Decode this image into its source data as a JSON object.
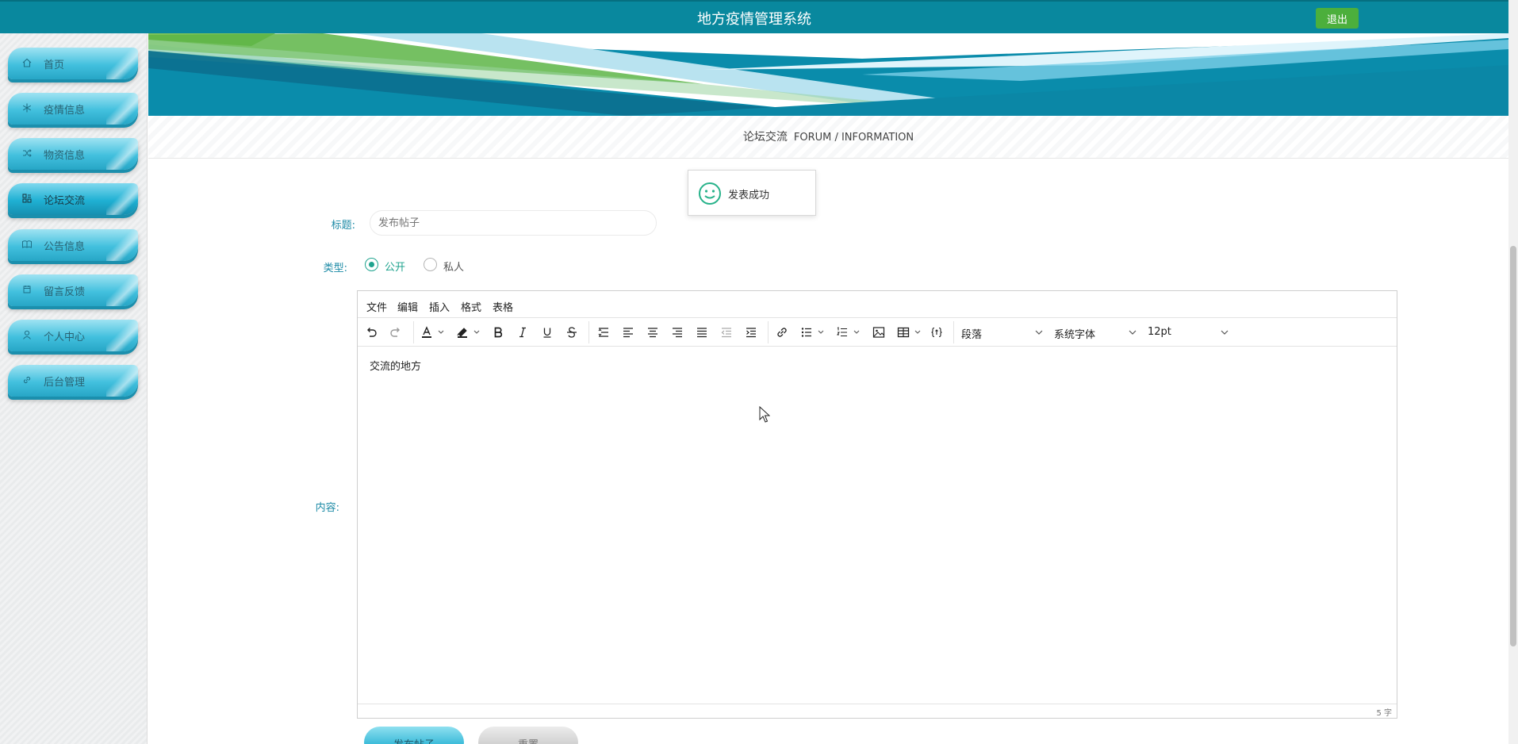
{
  "header": {
    "title": "地方疫情管理系统",
    "logout_label": "退出"
  },
  "sidebar": {
    "items": [
      {
        "label": "首页",
        "icon": "home-icon"
      },
      {
        "label": "疫情信息",
        "icon": "snowflake-icon"
      },
      {
        "label": "物资信息",
        "icon": "shuffle-icon"
      },
      {
        "label": "论坛交流",
        "icon": "forum-icon",
        "active": true
      },
      {
        "label": "公告信息",
        "icon": "book-icon"
      },
      {
        "label": "留言反馈",
        "icon": "calendar-icon"
      },
      {
        "label": "个人中心",
        "icon": "user-icon"
      },
      {
        "label": "后台管理",
        "icon": "link-icon"
      }
    ]
  },
  "section": {
    "title_cn": "论坛交流",
    "title_en": "FORUM / INFORMATION"
  },
  "toast": {
    "message": "发表成功",
    "icon": "smile-icon"
  },
  "form": {
    "title_label": "标题:",
    "title_placeholder": "发布帖子",
    "type_label": "类型:",
    "type_options": [
      {
        "label": "公开",
        "checked": true
      },
      {
        "label": "私人",
        "checked": false
      }
    ],
    "content_label": "内容:",
    "submit_label": "发布帖子",
    "reset_label": "重置"
  },
  "editor": {
    "menu": [
      "文件",
      "编辑",
      "插入",
      "格式",
      "表格"
    ],
    "block_format": "段落",
    "font_family": "系统字体",
    "font_size": "12pt",
    "content": "交流的地方",
    "word_count": "5 字"
  },
  "colors": {
    "header_bg": "#09889e",
    "logout_bg": "#4caf3c",
    "accent": "#1fa38e",
    "label_color": "#1c8aa6"
  }
}
